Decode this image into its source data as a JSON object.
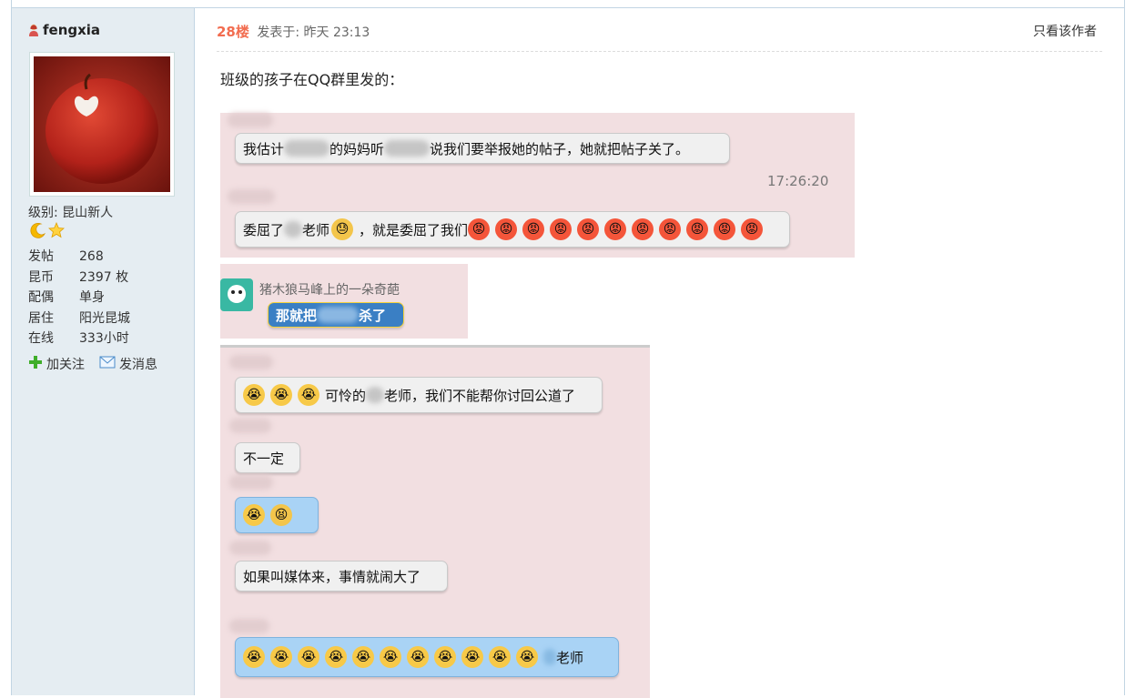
{
  "user": {
    "name": "fengxia",
    "level_label": "级别: 昆山新人",
    "stats": [
      {
        "k": "发帖",
        "v": "268"
      },
      {
        "k": "昆币",
        "v": "2397 枚"
      },
      {
        "k": "配偶",
        "v": "单身"
      },
      {
        "k": "居住",
        "v": "阳光昆城"
      },
      {
        "k": "在线",
        "v": "333小时"
      }
    ],
    "follow_label": "加关注",
    "message_label": "发消息"
  },
  "post": {
    "floor": "28楼",
    "posted": "发表于: 昨天 23:13",
    "only_author": "只看该作者",
    "intro": "班级的孩子在QQ群里发的："
  },
  "chat1": {
    "msg1_a": "我估计",
    "msg1_b": "的妈妈听",
    "msg1_c": "说我们要举报她的帖子，她就把帖子关了。",
    "time": "17:26:20",
    "msg2_a": "委屈了",
    "msg2_b": "老师",
    "msg2_c": "，就是委屈了我们"
  },
  "chat2": {
    "sender": "猪木狼马峰上的一朵奇葩",
    "msg_a": "那就把",
    "msg_b": "杀了"
  },
  "chat3": {
    "msg1_a": "可怜的",
    "msg1_b": "老师，我们不能帮你讨回公道了",
    "msg2": "不一定",
    "msg4": "如果叫媒体来，事情就闹大了",
    "msg5_tail": "老师"
  },
  "colors": {
    "accent": "#f26c4f",
    "sidebar_bg": "#e5edf2",
    "chat_bg": "#f2dfe1"
  }
}
